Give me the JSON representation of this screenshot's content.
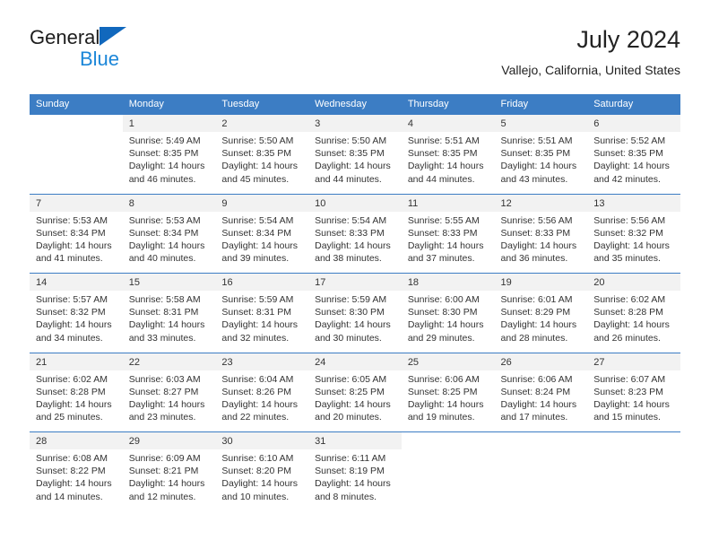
{
  "brand": {
    "name_part1": "General",
    "name_part2": "Blue",
    "triangle_color": "#1168bd",
    "blue_color": "#1b86d8"
  },
  "header": {
    "title": "July 2024",
    "subtitle": "Vallejo, California, United States"
  },
  "theme": {
    "header_bg": "#3c7dc4",
    "header_text": "#ffffff",
    "daynum_bg": "#f2f2f2",
    "body_text": "#333333"
  },
  "labels": {
    "sunrise": "Sunrise:",
    "sunset": "Sunset:",
    "daylight": "Daylight:"
  },
  "weekday_headers": [
    "Sunday",
    "Monday",
    "Tuesday",
    "Wednesday",
    "Thursday",
    "Friday",
    "Saturday"
  ],
  "weeks": [
    [
      {
        "day": ""
      },
      {
        "day": "1",
        "sunrise": "Sunrise: 5:49 AM",
        "sunset": "Sunset: 8:35 PM",
        "daylight": "Daylight: 14 hours and 46 minutes."
      },
      {
        "day": "2",
        "sunrise": "Sunrise: 5:50 AM",
        "sunset": "Sunset: 8:35 PM",
        "daylight": "Daylight: 14 hours and 45 minutes."
      },
      {
        "day": "3",
        "sunrise": "Sunrise: 5:50 AM",
        "sunset": "Sunset: 8:35 PM",
        "daylight": "Daylight: 14 hours and 44 minutes."
      },
      {
        "day": "4",
        "sunrise": "Sunrise: 5:51 AM",
        "sunset": "Sunset: 8:35 PM",
        "daylight": "Daylight: 14 hours and 44 minutes."
      },
      {
        "day": "5",
        "sunrise": "Sunrise: 5:51 AM",
        "sunset": "Sunset: 8:35 PM",
        "daylight": "Daylight: 14 hours and 43 minutes."
      },
      {
        "day": "6",
        "sunrise": "Sunrise: 5:52 AM",
        "sunset": "Sunset: 8:35 PM",
        "daylight": "Daylight: 14 hours and 42 minutes."
      }
    ],
    [
      {
        "day": "7",
        "sunrise": "Sunrise: 5:53 AM",
        "sunset": "Sunset: 8:34 PM",
        "daylight": "Daylight: 14 hours and 41 minutes."
      },
      {
        "day": "8",
        "sunrise": "Sunrise: 5:53 AM",
        "sunset": "Sunset: 8:34 PM",
        "daylight": "Daylight: 14 hours and 40 minutes."
      },
      {
        "day": "9",
        "sunrise": "Sunrise: 5:54 AM",
        "sunset": "Sunset: 8:34 PM",
        "daylight": "Daylight: 14 hours and 39 minutes."
      },
      {
        "day": "10",
        "sunrise": "Sunrise: 5:54 AM",
        "sunset": "Sunset: 8:33 PM",
        "daylight": "Daylight: 14 hours and 38 minutes."
      },
      {
        "day": "11",
        "sunrise": "Sunrise: 5:55 AM",
        "sunset": "Sunset: 8:33 PM",
        "daylight": "Daylight: 14 hours and 37 minutes."
      },
      {
        "day": "12",
        "sunrise": "Sunrise: 5:56 AM",
        "sunset": "Sunset: 8:33 PM",
        "daylight": "Daylight: 14 hours and 36 minutes."
      },
      {
        "day": "13",
        "sunrise": "Sunrise: 5:56 AM",
        "sunset": "Sunset: 8:32 PM",
        "daylight": "Daylight: 14 hours and 35 minutes."
      }
    ],
    [
      {
        "day": "14",
        "sunrise": "Sunrise: 5:57 AM",
        "sunset": "Sunset: 8:32 PM",
        "daylight": "Daylight: 14 hours and 34 minutes."
      },
      {
        "day": "15",
        "sunrise": "Sunrise: 5:58 AM",
        "sunset": "Sunset: 8:31 PM",
        "daylight": "Daylight: 14 hours and 33 minutes."
      },
      {
        "day": "16",
        "sunrise": "Sunrise: 5:59 AM",
        "sunset": "Sunset: 8:31 PM",
        "daylight": "Daylight: 14 hours and 32 minutes."
      },
      {
        "day": "17",
        "sunrise": "Sunrise: 5:59 AM",
        "sunset": "Sunset: 8:30 PM",
        "daylight": "Daylight: 14 hours and 30 minutes."
      },
      {
        "day": "18",
        "sunrise": "Sunrise: 6:00 AM",
        "sunset": "Sunset: 8:30 PM",
        "daylight": "Daylight: 14 hours and 29 minutes."
      },
      {
        "day": "19",
        "sunrise": "Sunrise: 6:01 AM",
        "sunset": "Sunset: 8:29 PM",
        "daylight": "Daylight: 14 hours and 28 minutes."
      },
      {
        "day": "20",
        "sunrise": "Sunrise: 6:02 AM",
        "sunset": "Sunset: 8:28 PM",
        "daylight": "Daylight: 14 hours and 26 minutes."
      }
    ],
    [
      {
        "day": "21",
        "sunrise": "Sunrise: 6:02 AM",
        "sunset": "Sunset: 8:28 PM",
        "daylight": "Daylight: 14 hours and 25 minutes."
      },
      {
        "day": "22",
        "sunrise": "Sunrise: 6:03 AM",
        "sunset": "Sunset: 8:27 PM",
        "daylight": "Daylight: 14 hours and 23 minutes."
      },
      {
        "day": "23",
        "sunrise": "Sunrise: 6:04 AM",
        "sunset": "Sunset: 8:26 PM",
        "daylight": "Daylight: 14 hours and 22 minutes."
      },
      {
        "day": "24",
        "sunrise": "Sunrise: 6:05 AM",
        "sunset": "Sunset: 8:25 PM",
        "daylight": "Daylight: 14 hours and 20 minutes."
      },
      {
        "day": "25",
        "sunrise": "Sunrise: 6:06 AM",
        "sunset": "Sunset: 8:25 PM",
        "daylight": "Daylight: 14 hours and 19 minutes."
      },
      {
        "day": "26",
        "sunrise": "Sunrise: 6:06 AM",
        "sunset": "Sunset: 8:24 PM",
        "daylight": "Daylight: 14 hours and 17 minutes."
      },
      {
        "day": "27",
        "sunrise": "Sunrise: 6:07 AM",
        "sunset": "Sunset: 8:23 PM",
        "daylight": "Daylight: 14 hours and 15 minutes."
      }
    ],
    [
      {
        "day": "28",
        "sunrise": "Sunrise: 6:08 AM",
        "sunset": "Sunset: 8:22 PM",
        "daylight": "Daylight: 14 hours and 14 minutes."
      },
      {
        "day": "29",
        "sunrise": "Sunrise: 6:09 AM",
        "sunset": "Sunset: 8:21 PM",
        "daylight": "Daylight: 14 hours and 12 minutes."
      },
      {
        "day": "30",
        "sunrise": "Sunrise: 6:10 AM",
        "sunset": "Sunset: 8:20 PM",
        "daylight": "Daylight: 14 hours and 10 minutes."
      },
      {
        "day": "31",
        "sunrise": "Sunrise: 6:11 AM",
        "sunset": "Sunset: 8:19 PM",
        "daylight": "Daylight: 14 hours and 8 minutes."
      },
      {
        "day": ""
      },
      {
        "day": ""
      },
      {
        "day": ""
      }
    ]
  ]
}
